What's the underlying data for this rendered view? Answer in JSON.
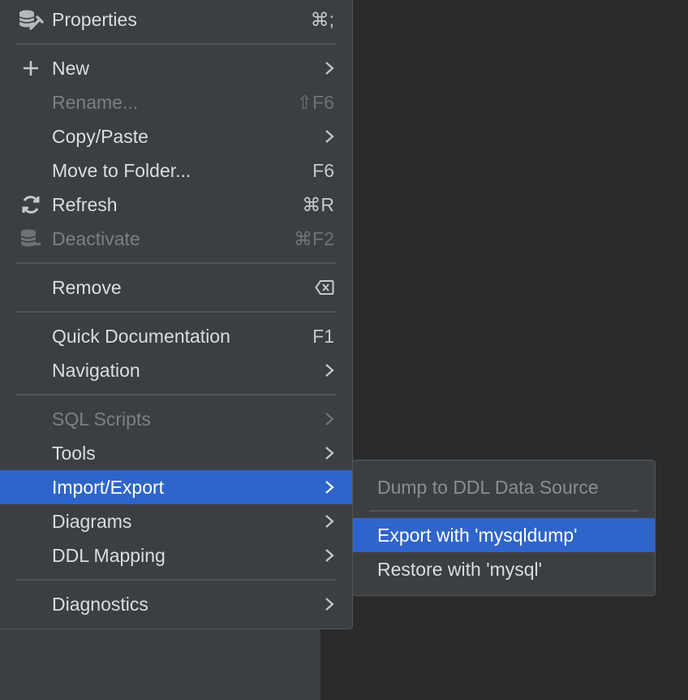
{
  "menu": {
    "items": [
      {
        "label": "Properties",
        "shortcut": "⌘;",
        "icon": "properties-icon"
      },
      {
        "label": "New",
        "icon": "plus-icon",
        "submenu": true
      },
      {
        "label": "Rename...",
        "shortcut": "⇧F6",
        "disabled": true
      },
      {
        "label": "Copy/Paste",
        "submenu": true
      },
      {
        "label": "Move to Folder...",
        "shortcut": "F6"
      },
      {
        "label": "Refresh",
        "shortcut": "⌘R",
        "icon": "refresh-icon"
      },
      {
        "label": "Deactivate",
        "shortcut": "⌘F2",
        "disabled": true,
        "icon": "deactivate-database-icon"
      },
      {
        "label": "Remove",
        "shortcut_icon": "delete-key-icon"
      },
      {
        "label": "Quick Documentation",
        "shortcut": "F1"
      },
      {
        "label": "Navigation",
        "submenu": true
      },
      {
        "label": "SQL Scripts",
        "submenu": true,
        "disabled": true
      },
      {
        "label": "Tools",
        "submenu": true
      },
      {
        "label": "Import/Export",
        "submenu": true,
        "selected": true
      },
      {
        "label": "Diagrams",
        "submenu": true
      },
      {
        "label": "DDL Mapping",
        "submenu": true
      },
      {
        "label": "Diagnostics",
        "submenu": true
      }
    ]
  },
  "submenu": {
    "items": [
      {
        "label": "Dump to DDL Data Source",
        "disabled": true
      },
      {
        "label": "Export with 'mysqldump'",
        "selected": true
      },
      {
        "label": "Restore with 'mysql'"
      }
    ]
  },
  "colors": {
    "menu_bg": "#3c3f42",
    "selection": "#2f65ca",
    "text": "#dcdcdc",
    "disabled_text": "#7c7f82",
    "editor_bg": "#2b2b2b"
  }
}
